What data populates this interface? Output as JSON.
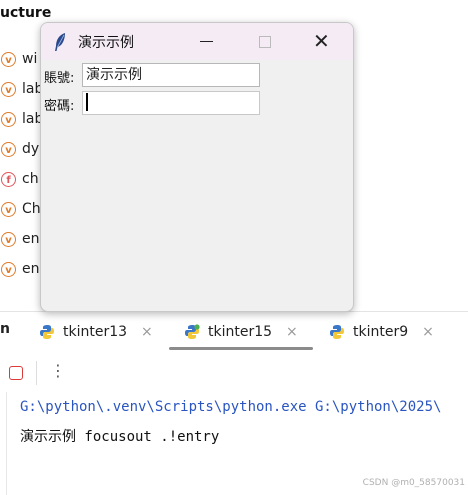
{
  "structure": {
    "title": "ucture",
    "items": [
      {
        "badge": "v",
        "label": "wi"
      },
      {
        "badge": "v",
        "label": "lab"
      },
      {
        "badge": "v",
        "label": "lab"
      },
      {
        "badge": "v",
        "label": "dy"
      },
      {
        "badge": "f",
        "label": "ch"
      },
      {
        "badge": "v",
        "label": "Ch"
      },
      {
        "badge": "v",
        "label": "en"
      },
      {
        "badge": "v",
        "label": "en"
      }
    ]
  },
  "tabs": {
    "run_label": "n",
    "items": [
      {
        "label": "tkinter13",
        "close": "×",
        "active": false
      },
      {
        "label": "tkinter15",
        "close": "×",
        "active": true
      },
      {
        "label": "tkinter9",
        "close": "×",
        "active": false
      }
    ]
  },
  "toolbar": {
    "more": "⋮"
  },
  "console": {
    "command": "G:\\python\\.venv\\Scripts\\python.exe G:\\python\\2025\\",
    "output": "演示示例 focusout .!entry"
  },
  "watermark": "CSDN @m0_58570031",
  "tk_window": {
    "title": "演示示例",
    "close_glyph": "✕",
    "fields": [
      {
        "label": "賬號:",
        "value": "演示示例"
      },
      {
        "label": "密碼:",
        "value": ""
      }
    ]
  },
  "colors": {
    "accent_orange": "#e07b2a",
    "stop_red": "#db3b3b",
    "console_path": "#2a55c0",
    "titlebar": "#f4ebf5"
  }
}
